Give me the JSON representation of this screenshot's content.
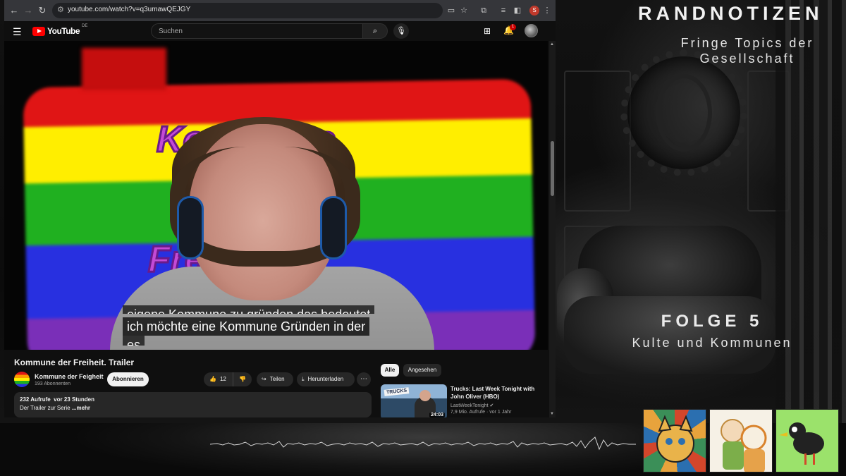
{
  "browser": {
    "url": "youtube.com/watch?v=q3umawQEJGY",
    "profile_initial": "S"
  },
  "youtube": {
    "logo_text": "YouTube",
    "country_code": "DE",
    "search_placeholder": "Suchen",
    "notification_count": "1"
  },
  "video": {
    "subtitle_line_partial": "eigene Kommune zu gründen das bedeutet",
    "subtitle_line_main": "ich möchte eine Kommune Gründen in der",
    "subtitle_line_next": "es",
    "overlay_text_top": "Kommune",
    "overlay_text_bottom": "Freiheit",
    "title": "Kommune der Freiheit. Trailer",
    "channel_name": "Kommune der Feigheit",
    "subscriber_count": "193 Abonnenten",
    "subscribe_label": "Abonnieren",
    "like_count": "12",
    "share_label": "Teilen",
    "download_label": "Herunterladen",
    "views": "232 Aufrufe",
    "uploaded": "vor 23 Stunden",
    "description": "Der Trailer zur Serie",
    "more_label": "...mehr"
  },
  "recommendations": {
    "chips": [
      "Alle",
      "Angesehen"
    ],
    "items": [
      {
        "title": "Trucks: Last Week Tonight with John Oliver (HBO)",
        "channel": "LastWeekTonight",
        "views": "7,9 Mio. Aufrufe",
        "age": "vor 1 Jahr",
        "duration": "24:03",
        "thumb_badge": "TRUCKS"
      }
    ]
  },
  "overlay": {
    "show_title": "RANDNOTIZEN",
    "show_subtitle": "Fringe Topics der Gesellschaft",
    "episode_number": "FOLGE 5",
    "episode_title": "Kulte und Kommunen"
  },
  "colors": {
    "youtube_red": "#ff0000",
    "chrome_bar": "#35363a",
    "yt_background": "#0f0f0f"
  }
}
